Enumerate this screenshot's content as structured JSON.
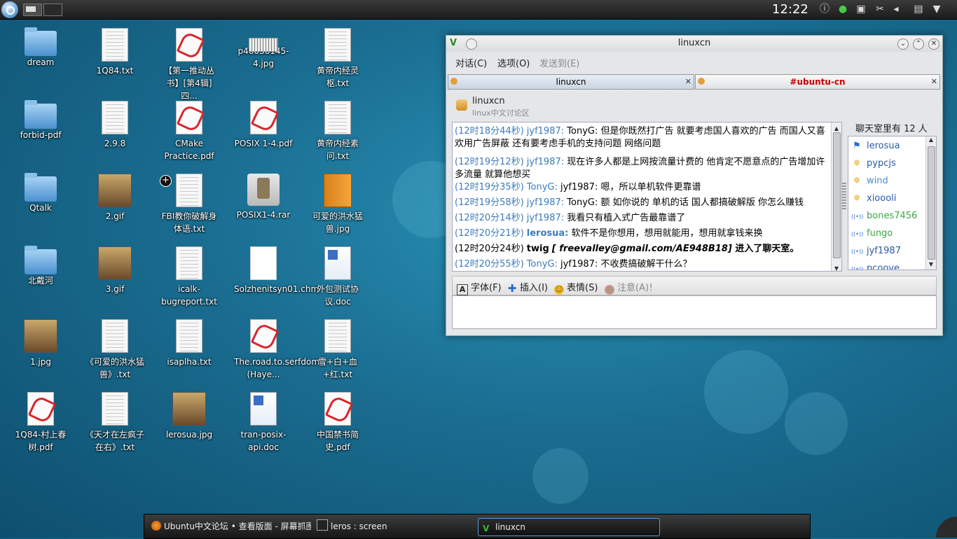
{
  "panel": {
    "clock": "12:22"
  },
  "desktop": {
    "icons": [
      {
        "label": "dream",
        "type": "folder"
      },
      {
        "label": "1Q84.txt",
        "type": "txt"
      },
      {
        "label": "【第一推动丛书】[第4辑]四...",
        "type": "pdf"
      },
      {
        "label": "p46036145-4.jpg",
        "type": "image"
      },
      {
        "label": "黄帝内经灵枢.txt",
        "type": "txt"
      },
      {
        "label": "forbid-pdf",
        "type": "folder"
      },
      {
        "label": "2.9.8",
        "type": "txt"
      },
      {
        "label": "CMake Practice.pdf",
        "type": "pdf"
      },
      {
        "label": "POSIX 1-4.pdf",
        "type": "pdf"
      },
      {
        "label": "黄帝内经素问.txt",
        "type": "txt"
      },
      {
        "label": "Qtalk",
        "type": "folder"
      },
      {
        "label": "2.gif",
        "type": "image"
      },
      {
        "label": "FBI教你破解身体语.txt",
        "type": "txt"
      },
      {
        "label": "POSIX1-4.rar",
        "type": "archive"
      },
      {
        "label": "可爱的洪水猛兽.jpg",
        "type": "image"
      },
      {
        "label": "北戴河",
        "type": "folder"
      },
      {
        "label": "3.gif",
        "type": "image"
      },
      {
        "label": "icalk-bugreport.txt",
        "type": "txt"
      },
      {
        "label": "Solzhenitsyn01.chm",
        "type": "chm"
      },
      {
        "label": "外包测试协议.doc",
        "type": "doc"
      },
      {
        "label": "1.jpg",
        "type": "image"
      },
      {
        "label": "《可爱的洪水猛兽》.txt",
        "type": "txt"
      },
      {
        "label": "isaplha.txt",
        "type": "txt"
      },
      {
        "label": "The.road.to.serfdom (Haye...",
        "type": "pdf"
      },
      {
        "label": "雪+白+血+红.txt",
        "type": "txt"
      },
      {
        "label": "1Q84-村上春树.pdf",
        "type": "pdf"
      },
      {
        "label": "《天才在左疯子在右》.txt",
        "type": "txt"
      },
      {
        "label": "lerosua.jpg",
        "type": "image"
      },
      {
        "label": "tran-posix-api.doc",
        "type": "doc"
      },
      {
        "label": "中国禁书简史.pdf",
        "type": "pdf"
      }
    ]
  },
  "chat_window": {
    "title": "linuxcn",
    "menu": [
      "对话(C)",
      "选项(O)",
      "发送到(E)"
    ],
    "tabs": [
      {
        "label": "linuxcn",
        "active": true
      },
      {
        "label": "#ubuntu-cn",
        "active": false,
        "color": "#cc0000"
      }
    ],
    "room": {
      "name": "linuxcn",
      "description": "linux中文讨论区"
    },
    "messages": [
      {
        "ts": "(12时18分44秒)",
        "who": "jyf1987:",
        "text": " TonyG: 但是你既然打广告 就要考虑国人喜欢的广告 而国人又喜欢用广告屏蔽 还有要考虑手机的支持问题 网络问题"
      },
      {
        "ts": "(12时19分12秒)",
        "who": "jyf1987:",
        "text": " 现在许多人都是上网按流量计费的 他肯定不愿意点的广告增加许多流量 就算他想买"
      },
      {
        "ts": "(12时19分35秒)",
        "who": "TonyG:",
        "text": " jyf1987: 嗯，所以单机软件更靠谱"
      },
      {
        "ts": "(12时19分58秒)",
        "who": "jyf1987:",
        "text": " TonyG: 额 如你说的 单机的话  国人都搞破解版 你怎么赚钱"
      },
      {
        "ts": "(12时20分14秒)",
        "who": "jyf1987:",
        "text": " 我看只有植入式广告最靠谱了"
      },
      {
        "ts": "(12时20分21秒)",
        "who": "lerosua:",
        "text": " 软件不是你想用，想用就能用，想用就拿钱来换"
      },
      {
        "ts": "(12时20分24秒)",
        "who": "twig",
        "email": "[ freevalley@gmail.com/AE948B18]",
        "text": " 进入了聊天室。"
      },
      {
        "ts": "(12时20分55秒)",
        "who": "TonyG:",
        "text": " jyf1987: 不收费搞破解干什么？"
      }
    ],
    "members_header": "聊天室里有 12 人",
    "members": [
      {
        "name": "lerosua",
        "icon": "flag-icon",
        "color": "#2a5aa8"
      },
      {
        "name": "pypcjs",
        "icon": "star-icon",
        "color": "#2a5aa8"
      },
      {
        "name": "wind",
        "icon": "star-icon",
        "color": "#4a8fd0"
      },
      {
        "name": "xioooli",
        "icon": "star-icon",
        "color": "#2a5aa8"
      },
      {
        "name": "bones7456",
        "icon": "signal-icon",
        "color": "#3aa845"
      },
      {
        "name": "fungo",
        "icon": "signal-icon",
        "color": "#3aa845"
      },
      {
        "name": "jyf1987",
        "icon": "signal-icon",
        "color": "#2a5aa8"
      },
      {
        "name": "pcoove",
        "icon": "signal-icon",
        "color": "#2a5aa8"
      }
    ],
    "toolbar": {
      "font": "字体(F)",
      "insert": "插入(I)",
      "emoticon": "表情(S)",
      "attention": "注意(A)！"
    }
  },
  "taskbar": {
    "tasks": [
      {
        "label": "Ubuntu中文论坛 • 查看版面 - 屏幕抓图 ...",
        "icon": "firefox-icon"
      },
      {
        "label": "leros : screen",
        "icon": "terminal-icon"
      },
      {
        "label": "linuxcn",
        "icon": "chat-app-icon",
        "active": true
      }
    ]
  }
}
